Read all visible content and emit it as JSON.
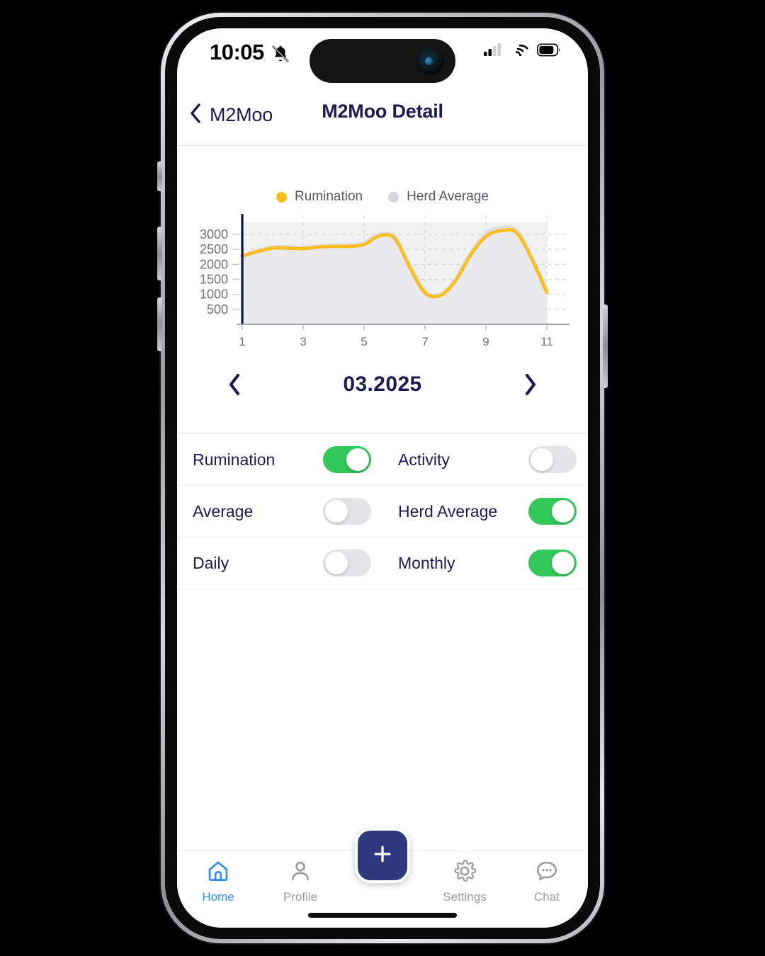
{
  "status_bar": {
    "time": "10:05",
    "bell_icon": "bell-slash-icon",
    "cellular_icon": "cellular-signal-icon",
    "wifi_icon": "wifi-icon",
    "battery_icon": "battery-icon"
  },
  "nav": {
    "back_label": "M2Moo",
    "back_icon": "chevron-left-icon",
    "title": "M2Moo Detail"
  },
  "chart_data": {
    "type": "line",
    "title": "",
    "xlabel": "",
    "ylabel": "",
    "legend_position": "top-center",
    "grid": true,
    "xlim": [
      1,
      11
    ],
    "ylim": [
      0,
      3400
    ],
    "yticks": [
      500,
      1000,
      1500,
      2000,
      2500,
      3000
    ],
    "xticks": [
      1,
      3,
      5,
      7,
      9,
      11
    ],
    "x": [
      1,
      1.5,
      2,
      2.5,
      3,
      3.5,
      4,
      4.5,
      5,
      5.5,
      6,
      6.5,
      7,
      7.5,
      8,
      8.5,
      9,
      9.5,
      10,
      10.5,
      11
    ],
    "series": [
      {
        "name": "Rumination",
        "color": "#fcbe1e",
        "values": [
          2280,
          2430,
          2540,
          2540,
          2520,
          2580,
          2600,
          2600,
          2660,
          2950,
          2870,
          1900,
          1050,
          960,
          1450,
          2320,
          2930,
          3120,
          3060,
          2200,
          1060
        ]
      },
      {
        "name": "Herd Average",
        "color": "#d4d4d8",
        "values": [
          2280,
          2430,
          2560,
          2560,
          2540,
          2590,
          2620,
          2620,
          2700,
          2970,
          2890,
          1920,
          1070,
          980,
          1470,
          2350,
          3010,
          3200,
          3120,
          2230,
          1070
        ]
      }
    ],
    "legend": [
      {
        "label": "Rumination",
        "color": "#fcbe1e"
      },
      {
        "label": "Herd Average",
        "color": "#d4d4d8"
      }
    ]
  },
  "month_nav": {
    "prev_icon": "chevron-left-icon",
    "next_icon": "chevron-right-icon",
    "label": "03.2025"
  },
  "toggles": [
    [
      {
        "label": "Rumination",
        "state": "on"
      },
      {
        "label": "Activity",
        "state": "off"
      }
    ],
    [
      {
        "label": "Average",
        "state": "off"
      },
      {
        "label": "Herd Average",
        "state": "on"
      }
    ],
    [
      {
        "label": "Daily",
        "state": "off"
      },
      {
        "label": "Monthly",
        "state": "on"
      }
    ]
  ],
  "tabbar": {
    "items": [
      {
        "label": "Home",
        "icon": "home-icon",
        "active": true
      },
      {
        "label": "Profile",
        "icon": "person-icon",
        "active": false
      },
      {
        "label": "Settings",
        "icon": "gear-icon",
        "active": false
      },
      {
        "label": "Chat",
        "icon": "chat-bubble-icon",
        "active": false
      }
    ],
    "fab_icon": "plus-icon"
  },
  "colors": {
    "accent_yellow": "#fcbe1e",
    "herd_gray": "#d4d4d8",
    "toggle_on": "#34c759",
    "toggle_off": "#e4e4e8",
    "navy": "#1c1a4e",
    "tab_active": "#2d8cf0",
    "fab": "#2e3a7d"
  }
}
